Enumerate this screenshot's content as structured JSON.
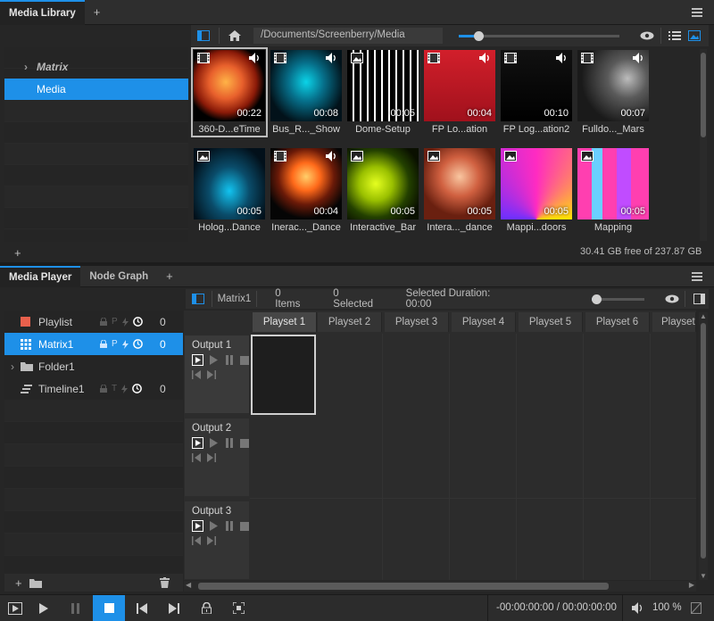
{
  "library": {
    "tabs": [
      {
        "label": "Media Library"
      }
    ],
    "path": "/Documents/Screenberry/Media",
    "tree": [
      {
        "label": "Matrix"
      },
      {
        "label": "Media"
      }
    ],
    "free_space": "30.41 GB free of 237.87 GB",
    "thumbs": [
      {
        "label": "360-D...eTime",
        "duration": "00:22",
        "type": "video"
      },
      {
        "label": "Bus_R..._Show",
        "duration": "00:08",
        "type": "video"
      },
      {
        "label": "Dome-Setup",
        "duration": "00:05",
        "type": "image"
      },
      {
        "label": "FP Lo...ation",
        "duration": "00:04",
        "type": "video"
      },
      {
        "label": "FP Log...ation2",
        "duration": "00:10",
        "type": "video"
      },
      {
        "label": "Fulldo..._Mars",
        "duration": "00:07",
        "type": "video"
      },
      {
        "label": "Holog...Dance",
        "duration": "00:05",
        "type": "image"
      },
      {
        "label": "Inerac..._Dance",
        "duration": "00:04",
        "type": "video"
      },
      {
        "label": "Interactive_Bar",
        "duration": "00:05",
        "type": "image"
      },
      {
        "label": "Intera..._dance",
        "duration": "00:05",
        "type": "image"
      },
      {
        "label": "Mappi...doors",
        "duration": "00:05",
        "type": "image"
      },
      {
        "label": "Mapping",
        "duration": "00:05",
        "type": "image"
      }
    ]
  },
  "player": {
    "tabs": [
      {
        "label": "Media Player"
      },
      {
        "label": "Node Graph"
      }
    ],
    "breadcrumb": "Matrix1",
    "items_count": "0 Items",
    "selected_count": "0 Selected",
    "selected_duration": "Selected Duration: 00:00",
    "list": [
      {
        "label": "Playlist",
        "count": "0"
      },
      {
        "label": "Matrix1",
        "count": "0"
      },
      {
        "label": "Folder1",
        "count": ""
      },
      {
        "label": "Timeline1",
        "count": "0"
      }
    ],
    "playsets": [
      "Playset 1",
      "Playset 2",
      "Playset 3",
      "Playset 4",
      "Playset 5",
      "Playset 6",
      "Playset"
    ],
    "outputs": [
      "Output 1",
      "Output 2",
      "Output 3"
    ],
    "timecode": "-00:00:00:00 / 00:00:00:00",
    "volume": "100 %"
  },
  "colors": {
    "accent": "#1e90e8",
    "playlist_icon": "#e8604c"
  }
}
